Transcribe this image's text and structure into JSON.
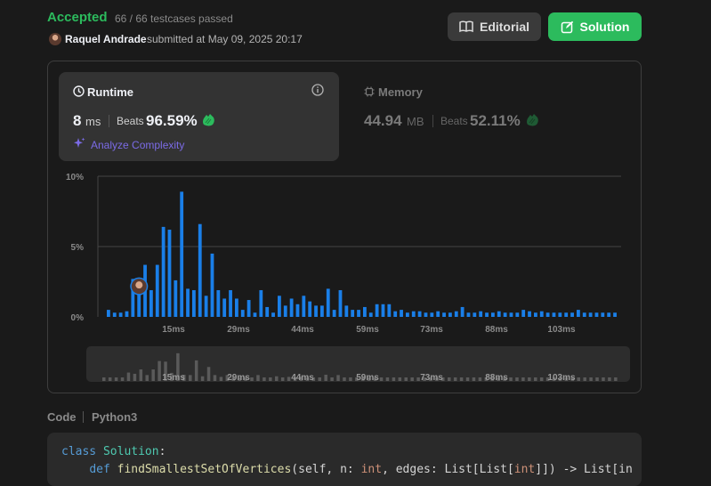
{
  "header": {
    "status": "Accepted",
    "testcases": "66 / 66 testcases passed",
    "author": "Raquel Andrade",
    "submitted_text": "submitted at May 09, 2025 20:17",
    "editorial_label": "Editorial",
    "solution_label": "Solution"
  },
  "runtime": {
    "title": "Runtime",
    "value": "8",
    "unit": "ms",
    "beats_label": "Beats",
    "beats": "96.59%",
    "analyze_label": "Analyze Complexity"
  },
  "memory": {
    "title": "Memory",
    "value": "44.94",
    "unit": "MB",
    "beats_label": "Beats",
    "beats": "52.11%"
  },
  "icons": {
    "runtime": "clock-icon",
    "info": "info-icon",
    "memory": "chip-icon",
    "analyze": "sparkle-icon",
    "editorial": "book-icon",
    "solution": "edit-icon",
    "beats": "clap-icon"
  },
  "colors": {
    "accepted": "#2cbb5d",
    "bar": "#1a7fe8",
    "analyze": "#7b6be6",
    "solution_button": "#2cbb5d"
  },
  "chart_data": {
    "type": "bar",
    "y_ticks": [
      "10%",
      "5%",
      "0%"
    ],
    "ylim": [
      0,
      10
    ],
    "x_ticks": [
      "15ms",
      "29ms",
      "44ms",
      "59ms",
      "73ms",
      "88ms",
      "103ms"
    ],
    "values": [
      0.5,
      0.3,
      0.3,
      0.4,
      2.7,
      2.3,
      3.7,
      1.9,
      3.7,
      6.4,
      6.2,
      2.6,
      8.9,
      2.0,
      1.9,
      6.6,
      1.5,
      4.5,
      1.9,
      1.3,
      1.9,
      1.3,
      0.5,
      1.2,
      0.3,
      1.9,
      0.7,
      0.3,
      1.5,
      0.8,
      1.3,
      0.9,
      1.5,
      1.1,
      0.8,
      0.8,
      2.0,
      0.5,
      1.9,
      0.8,
      0.5,
      0.5,
      0.7,
      0.3,
      0.9,
      0.9,
      0.9,
      0.4,
      0.5,
      0.3,
      0.4,
      0.4,
      0.3,
      0.3,
      0.4,
      0.3,
      0.3,
      0.4,
      0.7,
      0.3,
      0.3,
      0.4,
      0.3,
      0.3,
      0.4,
      0.3,
      0.3,
      0.3,
      0.5,
      0.4,
      0.3,
      0.4,
      0.3,
      0.3,
      0.3,
      0.3,
      0.3,
      0.5,
      0.3,
      0.3,
      0.3,
      0.3,
      0.3,
      0.3
    ],
    "user_value_ms": "8",
    "grid": true
  },
  "code": {
    "label": "Code",
    "language": "Python3",
    "line1": "Solution",
    "line2_fn": "findSmallestSetOfVertices",
    "line2_args": "(self, n: ",
    "line2_int": "int",
    "line2_mid": ", edges: List[List[",
    "line2_int2": "int",
    "line2_end": "]]) -> List[in"
  }
}
